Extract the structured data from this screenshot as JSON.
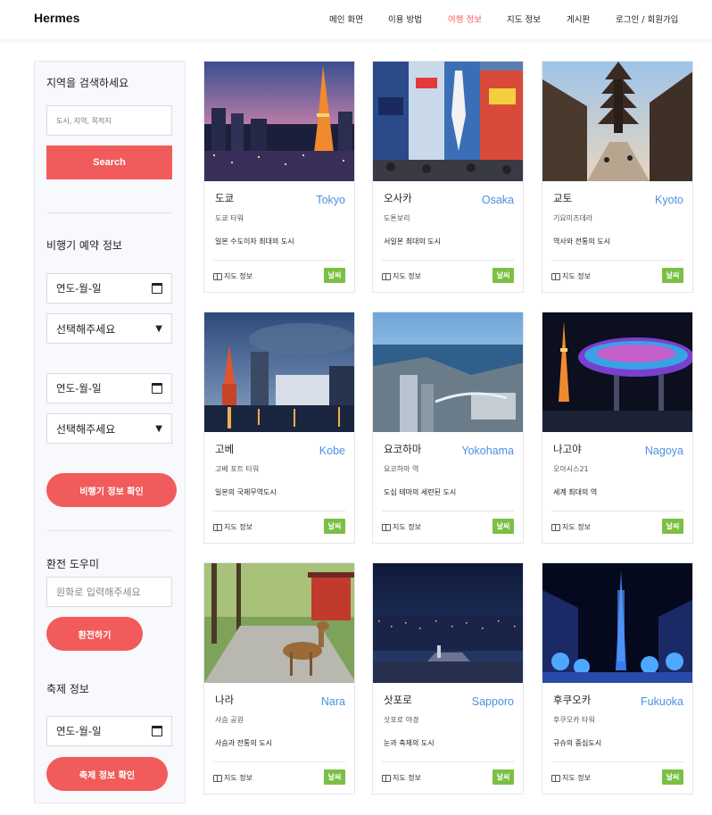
{
  "header": {
    "brand": "Hermes",
    "nav": [
      {
        "label": "메인 화면",
        "active": false
      },
      {
        "label": "이용 방법",
        "active": false
      },
      {
        "label": "여행 정보",
        "active": true
      },
      {
        "label": "지도 정보",
        "active": false
      },
      {
        "label": "게시판",
        "active": false
      },
      {
        "label": "로그인 / 회원가입",
        "active": false
      }
    ]
  },
  "sidebar": {
    "search_title": "지역을 검색하세요",
    "search_placeholder": "도시, 지역, 목적지",
    "search_button": "Search",
    "flight_title": "비행기 예약 정보",
    "date_placeholder": "연도-월-일",
    "select_placeholder": "선택해주세요",
    "flight_button": "비행기 정보 확인",
    "exchange_title": "환전 도우미",
    "exchange_placeholder": "원화로 입력해주세요",
    "exchange_button": "환전하기",
    "festival_title": "축제 정보",
    "festival_button": "축제 정보 확인"
  },
  "cards": [
    {
      "ko": "도쿄",
      "en": "Tokyo",
      "sub": "도쿄 타워",
      "desc": "일본 수도이자 최대의 도시",
      "map": "지도 정보",
      "badge": "날씨"
    },
    {
      "ko": "오사카",
      "en": "Osaka",
      "sub": "도톤보리",
      "desc": "서일본 최대의 도시",
      "map": "지도 정보",
      "badge": "날씨"
    },
    {
      "ko": "교토",
      "en": "Kyoto",
      "sub": "기요미즈데라",
      "desc": "역사와 전통의 도시",
      "map": "지도 정보",
      "badge": "날씨"
    },
    {
      "ko": "고베",
      "en": "Kobe",
      "sub": "고베 포트 타워",
      "desc": "일본의 국제무역도시",
      "map": "지도 정보",
      "badge": "날씨"
    },
    {
      "ko": "요코하마",
      "en": "Yokohama",
      "sub": "요코하마 역",
      "desc": "도심 테마의 세련된 도시",
      "map": "지도 정보",
      "badge": "날씨"
    },
    {
      "ko": "나고야",
      "en": "Nagoya",
      "sub": "오아시스21",
      "desc": "세계 최대의 역",
      "map": "지도 정보",
      "badge": "날씨"
    },
    {
      "ko": "나라",
      "en": "Nara",
      "sub": "사슴 공원",
      "desc": "사슴과 전통의 도시",
      "map": "지도 정보",
      "badge": "날씨"
    },
    {
      "ko": "삿포로",
      "en": "Sapporo",
      "sub": "삿포로 야경",
      "desc": "눈과 축제의 도시",
      "map": "지도 정보",
      "badge": "날씨"
    },
    {
      "ko": "후쿠오카",
      "en": "Fukuoka",
      "sub": "후쿠오카 타워",
      "desc": "규슈의 중심도시",
      "map": "지도 정보",
      "badge": "날씨"
    }
  ]
}
